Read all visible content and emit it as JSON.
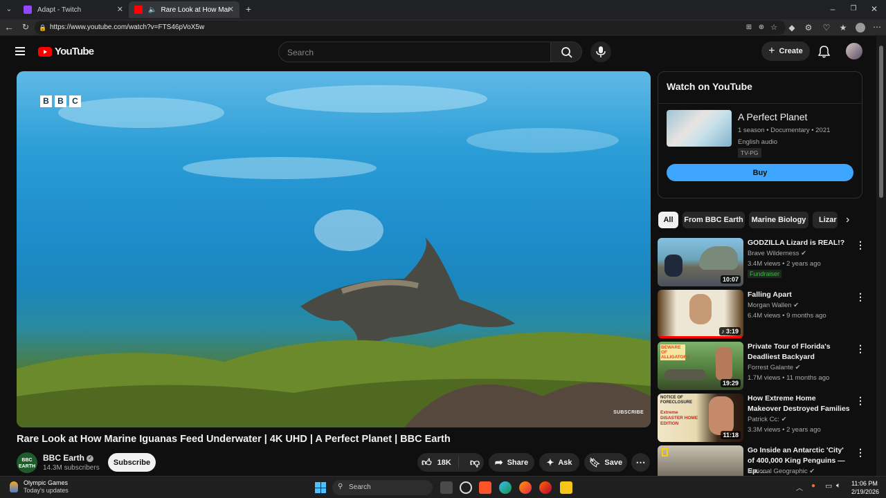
{
  "browser": {
    "tabs": [
      {
        "label": "Adapt - Twitch",
        "active": false
      },
      {
        "label": "Rare Look at How Marine Igua",
        "active": true
      }
    ],
    "url": "https://www.youtube.com/watch?v=FTS46pVoX5w"
  },
  "header": {
    "logo": "YouTube",
    "search_placeholder": "Search",
    "create_label": "Create"
  },
  "video": {
    "brand_letters": [
      "B",
      "B",
      "C"
    ],
    "watermark": "SUBSCRIBE",
    "title": "Rare Look at How Marine Iguanas Feed Underwater | 4K UHD | A Perfect Planet | BBC Earth"
  },
  "channel": {
    "avatar_text": "BBC EARTH",
    "name": "BBC Earth",
    "subscribers": "14.3M subscribers",
    "subscribe_label": "Subscribe"
  },
  "actions": {
    "likes": "18K",
    "share": "Share",
    "ask": "Ask",
    "save": "Save"
  },
  "watch_panel": {
    "heading": "Watch on YouTube",
    "name": "A Perfect Planet",
    "meta": "1 season • Documentary • 2021",
    "audio": "English audio",
    "rating": "TV-PG",
    "buy_label": "Buy"
  },
  "chips": [
    "All",
    "From BBC Earth",
    "Marine Biology",
    "Lizar"
  ],
  "recommendations": [
    {
      "title": "GODZILLA Lizard is REAL!?",
      "channel": "Brave Wilderness",
      "views": "3.4M views • 2 years ago",
      "duration": "10:07",
      "badge": "Fundraiser"
    },
    {
      "title": "Falling Apart",
      "channel": "Morgan Wallen",
      "views": "6.4M views • 9 months ago",
      "duration": "3:19"
    },
    {
      "title": "Private Tour of Florida's Deadliest Backyard",
      "channel": "Forrest Galante",
      "views": "1.7M views • 11 months ago",
      "duration": "19:29"
    },
    {
      "title": "How Extreme Home Makeover Destroyed Families",
      "channel": "Patrick Cc:",
      "views": "3.3M views • 2 years ago",
      "duration": "11:18"
    },
    {
      "title": "Go Inside an Antarctic 'City' of 400,000 King Penguins — Ep. ...",
      "channel": "National Geographic",
      "views": ""
    }
  ],
  "thumb_texts": {
    "beware": "BEWARE OF ALLIGATORS",
    "notice": "NOTICE OF FORECLOSURE",
    "extreme": "Extreme DISASTER HOME EDITION"
  },
  "taskbar": {
    "weather_title": "Olympic Games",
    "weather_sub": "Today's updates",
    "search_label": "Search",
    "time": "11:06 PM",
    "date": "2/19/2026"
  },
  "colors": {
    "accent_blue": "#3ea6ff",
    "youtube_red": "#ff0000",
    "background": "#0f0f0f"
  }
}
